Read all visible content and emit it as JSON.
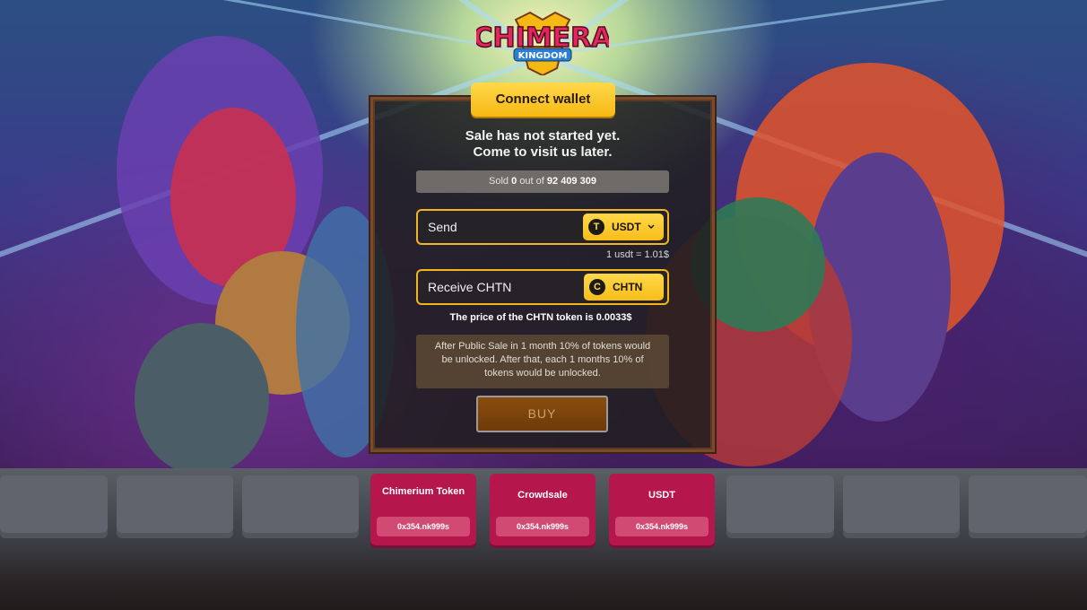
{
  "brand": {
    "logo_line1": "CHIMERA",
    "logo_line2": "KINGDOM"
  },
  "header": {
    "connect_label": "Connect wallet"
  },
  "sale": {
    "status_line1": "Sale has not started yet.",
    "status_line2": "Come to visit us later.",
    "sold_prefix": "Sold",
    "sold_value": "0",
    "sold_middle": "out of",
    "sold_total": "92 409 309"
  },
  "send": {
    "label": "Send",
    "token": "USDT",
    "token_glyph": "T",
    "rate": "1 usdt = 1.01$"
  },
  "receive": {
    "label": "Receive CHTN",
    "token": "CHTN",
    "token_glyph": "C"
  },
  "price_text": "The price of the CHTN token is 0.0033$",
  "info_text": "After Public Sale in 1 month 10% of tokens would be unlocked. After that, each 1 months 10% of tokens would be unlocked.",
  "buy_label": "BUY",
  "contracts": [
    {
      "title": "Chimerium Token",
      "address": "0x354.nk999s"
    },
    {
      "title": "Crowdsale",
      "address": "0x354.nk999s"
    },
    {
      "title": "USDT",
      "address": "0x354.nk999s"
    }
  ],
  "colors": {
    "accent": "#f6b913",
    "card": "#b5164c",
    "panel_border": "#7a4a2a"
  },
  "icons": {
    "dropdown": "chevron-down-icon",
    "usdt": "tether-icon",
    "chtn": "chtn-coin-icon"
  }
}
